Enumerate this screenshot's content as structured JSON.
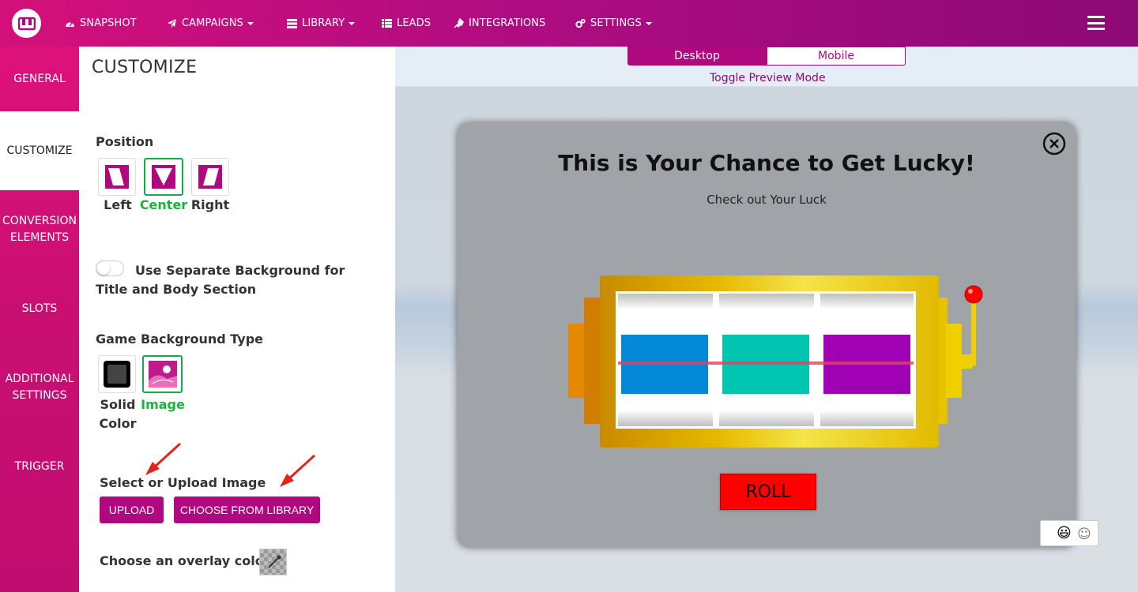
{
  "nav": {
    "items": [
      {
        "label": "SNAPSHOT",
        "icon": "dashboard-icon"
      },
      {
        "label": "CAMPAIGNS",
        "icon": "paper-plane-icon"
      },
      {
        "label": "LIBRARY",
        "icon": "server-icon"
      },
      {
        "label": "LEADS",
        "icon": "list-icon"
      },
      {
        "label": "INTEGRATIONS",
        "icon": "plug-icon"
      },
      {
        "label": "SETTINGS",
        "icon": "cogs-icon"
      }
    ],
    "accent": "#b0087e"
  },
  "sidebar": {
    "tabs": [
      {
        "label": "GENERAL"
      },
      {
        "label": "CUSTOMIZE"
      },
      {
        "label": "CONVERSION ELEMENTS"
      },
      {
        "label": "SLOTS"
      },
      {
        "label": "ADDITIONAL SETTINGS"
      },
      {
        "label": "TRIGGER"
      }
    ],
    "active": "CUSTOMIZE"
  },
  "panel": {
    "title": "CUSTOMIZE",
    "position": {
      "label": "Position",
      "options": [
        "Left",
        "Center",
        "Right"
      ],
      "selected": "Center"
    },
    "separate_bg": {
      "label": "Use Separate Background for Title and Body Section",
      "enabled": false
    },
    "bg_type": {
      "label": "Game Background Type",
      "options": [
        "Solid Color",
        "Image"
      ],
      "selected": "Image"
    },
    "image": {
      "label": "Select or Upload Image",
      "upload_label": "UPLOAD",
      "library_label": "CHOOSE FROM LIBRARY"
    },
    "overlay": {
      "label": "Choose an overlay color"
    }
  },
  "preview": {
    "modes": [
      "Desktop",
      "Mobile"
    ],
    "active_mode": "Desktop",
    "toggle_label": "Toggle Preview Mode",
    "game": {
      "title": "This is Your Chance to Get Lucky!",
      "subtitle": "Check out Your Luck",
      "roll_label": "ROLL",
      "reel_colors": [
        "#0288d6",
        "#00c5b1",
        "#a001b5"
      ]
    }
  }
}
